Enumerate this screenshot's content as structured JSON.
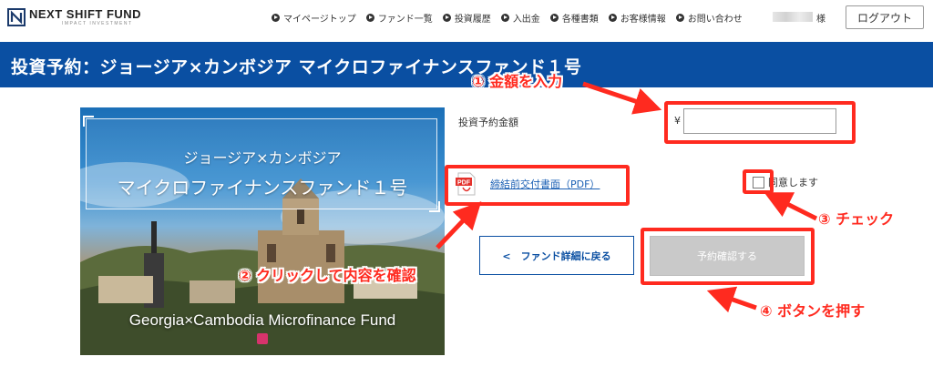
{
  "header": {
    "logo_name": "NEXT SHIFT FUND",
    "logo_sub": "IMPACT INVESTMENT",
    "nav": [
      {
        "label": "マイページトップ"
      },
      {
        "label": "ファンド一覧"
      },
      {
        "label": "投資履歴"
      },
      {
        "label": "入出金"
      },
      {
        "label": "各種書類"
      },
      {
        "label": "お客様情報"
      },
      {
        "label": "お問い合わせ"
      }
    ],
    "user_suffix": "様",
    "logout_label": "ログアウト"
  },
  "page": {
    "title": "投資予約：ジョージア×カンボジア マイクロファイナンスファンド１号"
  },
  "fund_image": {
    "jp_line1": "ジョージア×カンボジア",
    "jp_line2": "マイクロファイナンスファンド１号",
    "en_title": "Georgia×Cambodia Microfinance Fund"
  },
  "form": {
    "amount_label": "投資予約金額",
    "currency_symbol": "¥",
    "amount_value": "",
    "pdf_link_label": "締結前交付書面（PDF）",
    "pdf_icon_text": "PDF",
    "agree_label": "同意します",
    "back_label": "<　ファンド詳細に戻る",
    "confirm_label": "予約確認する"
  },
  "annotations": {
    "step1": "① 金額を入力",
    "step2": "② クリックして内容を確認",
    "step3": "③ チェック",
    "step4": "④ ボタンを押す"
  },
  "colors": {
    "brand_blue": "#0a4fa2",
    "annotation_red": "#ff2a1f",
    "confirm_disabled": "#c9c9c9",
    "link_blue": "#1a5fb4"
  }
}
